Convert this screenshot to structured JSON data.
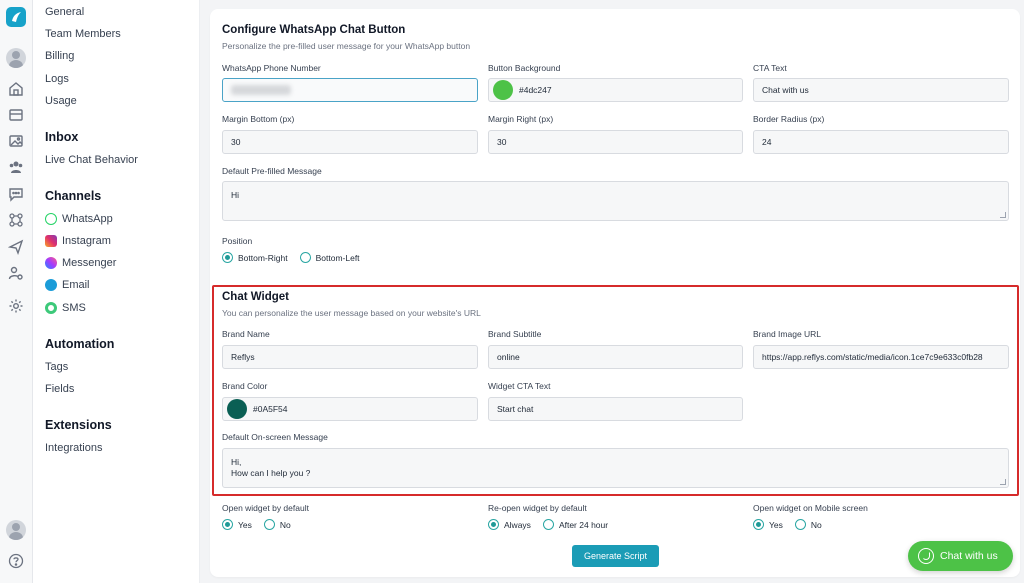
{
  "nav": {
    "account_items": [
      "General",
      "Team Members",
      "Billing",
      "Logs",
      "Usage"
    ],
    "inbox": {
      "heading": "Inbox",
      "items": [
        "Live Chat Behavior"
      ]
    },
    "channels": {
      "heading": "Channels",
      "items": [
        {
          "label": "WhatsApp",
          "icon": "whatsapp-icon",
          "color": "#25d366"
        },
        {
          "label": "Instagram",
          "icon": "instagram-icon",
          "color": "#e1306c"
        },
        {
          "label": "Messenger",
          "icon": "messenger-icon",
          "color": "#7a5cff"
        },
        {
          "label": "Email",
          "icon": "email-icon",
          "color": "#1b9cd8"
        },
        {
          "label": "SMS",
          "icon": "sms-icon",
          "color": "#3dc97a"
        }
      ]
    },
    "automation": {
      "heading": "Automation",
      "items": [
        "Tags",
        "Fields"
      ]
    },
    "extensions": {
      "heading": "Extensions",
      "items": [
        "Integrations"
      ]
    }
  },
  "whatsapp_button": {
    "title": "Configure WhatsApp Chat Button",
    "subtitle": "Personalize the pre-filled user message for your WhatsApp button",
    "phone_label": "WhatsApp Phone Number",
    "background_label": "Button Background",
    "background_value": "#4dc247",
    "cta_label": "CTA Text",
    "cta_value": "Chat with us",
    "margin_bottom_label": "Margin Bottom (px)",
    "margin_bottom_value": "30",
    "margin_right_label": "Margin Right (px)",
    "margin_right_value": "30",
    "border_radius_label": "Border Radius (px)",
    "border_radius_value": "24",
    "message_label": "Default Pre-filled Message",
    "message_value": "Hi",
    "position_label": "Position",
    "position_options": [
      "Bottom-Right",
      "Bottom-Left"
    ],
    "position_selected": "Bottom-Right"
  },
  "chat_widget": {
    "title": "Chat Widget",
    "subtitle": "You can personalize the user message based on your website's URL",
    "brand_name_label": "Brand Name",
    "brand_name_value": "Reflys",
    "brand_subtitle_label": "Brand Subtitle",
    "brand_subtitle_value": "online",
    "brand_image_label": "Brand Image URL",
    "brand_image_value": "https://app.reflys.com/static/media/icon.1ce7c9e633c0fb28",
    "brand_color_label": "Brand Color",
    "brand_color_value": "#0A5F54",
    "widget_cta_label": "Widget CTA Text",
    "widget_cta_value": "Start chat",
    "onscreen_label": "Default On-screen Message",
    "onscreen_line1": "Hi,",
    "onscreen_line2": "How can I help you ?"
  },
  "options": {
    "open_default_label": "Open widget by default",
    "open_default_options": [
      "Yes",
      "No"
    ],
    "open_default_selected": "Yes",
    "reopen_label": "Re-open widget by default",
    "reopen_options": [
      "Always",
      "After 24 hour"
    ],
    "reopen_selected": "Always",
    "mobile_label": "Open widget on Mobile screen",
    "mobile_options": [
      "Yes",
      "No"
    ],
    "mobile_selected": "Yes"
  },
  "actions": {
    "generate_label": "Generate Script",
    "floating_label": "Chat with us"
  },
  "colors": {
    "accent": "#1b9cb6",
    "highlight_border": "#d62b2b",
    "whatsapp_green": "#4dc247",
    "brand_color": "#0A5F54"
  }
}
